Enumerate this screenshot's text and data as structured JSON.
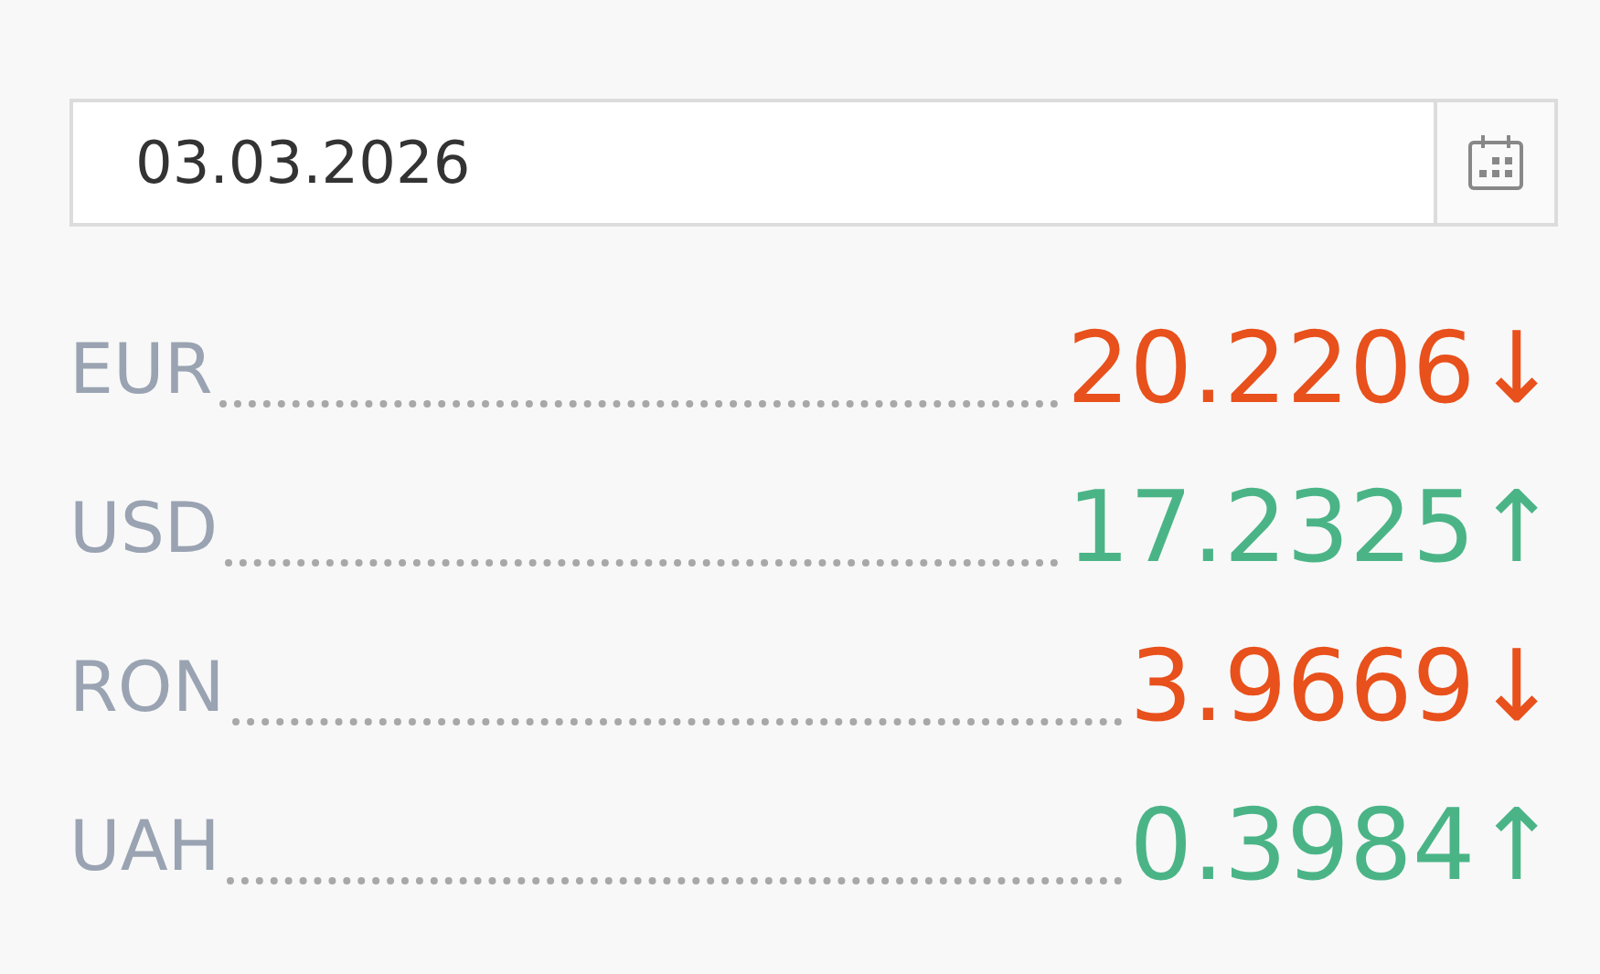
{
  "date_field": {
    "value": "03.03.2026"
  },
  "rates": [
    {
      "currency": "EUR",
      "value": "20.2206",
      "arrow": "↓",
      "color": "#e8501c"
    },
    {
      "currency": "USD",
      "value": "17.2325",
      "arrow": "↑",
      "color": "#4bb487"
    },
    {
      "currency": "RON",
      "value": "3.9669",
      "arrow": "↓",
      "color": "#e8501c"
    },
    {
      "currency": "UAH",
      "value": "0.3984",
      "arrow": "↑",
      "color": "#4bb487"
    }
  ]
}
